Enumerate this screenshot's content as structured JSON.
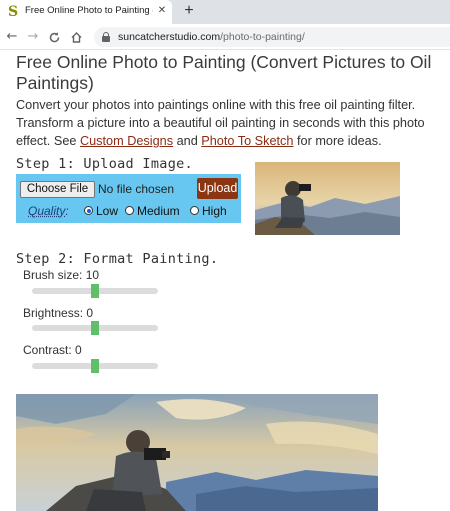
{
  "browser": {
    "tab_favicon": "S",
    "tab_title": "Free Online Photo to Painting (C",
    "tab_close": "✕",
    "new_tab": "+",
    "url_domain": "suncatcherstudio.com",
    "url_path": "/photo-to-painting/",
    "icons": [
      "back-arrow-icon",
      "forward-arrow-icon",
      "reload-icon",
      "home-icon",
      "lock-icon"
    ]
  },
  "page": {
    "title": "Free Online Photo to Painting (Convert Pictures to Oil Paintings)",
    "intro_text": "Convert your photos into paintings online with this free oil painting filter. Transform a picture into a beautiful oil painting in seconds with this photo effect. See",
    "link_custom_designs": "Custom Designs",
    "and_text": "and",
    "link_photo_to_sketch": "Photo To Sketch",
    "ending_text": "for more ideas."
  },
  "step1": {
    "heading": "Step 1: Upload Image.",
    "choose_file": "Choose File",
    "no_file": "No file chosen",
    "upload": "Upload",
    "quality_label": "Quality",
    "quality_colon": ":",
    "options": [
      "Low",
      "Medium",
      "High"
    ],
    "selected": "Low"
  },
  "step2": {
    "heading": "Step 2: Format Painting.",
    "sliders": [
      {
        "label": "Brush size: 10",
        "value": 10,
        "fraction": 0.5
      },
      {
        "label": "Brightness: 0",
        "value": 0,
        "fraction": 0.5
      },
      {
        "label": "Contrast: 0",
        "value": 0,
        "fraction": 0.5
      }
    ]
  },
  "colors": {
    "upload_box": "#67c7f0",
    "upload_button": "#8b3513",
    "link": "#8a2b14",
    "slider_thumb": "#5fbf6a"
  }
}
